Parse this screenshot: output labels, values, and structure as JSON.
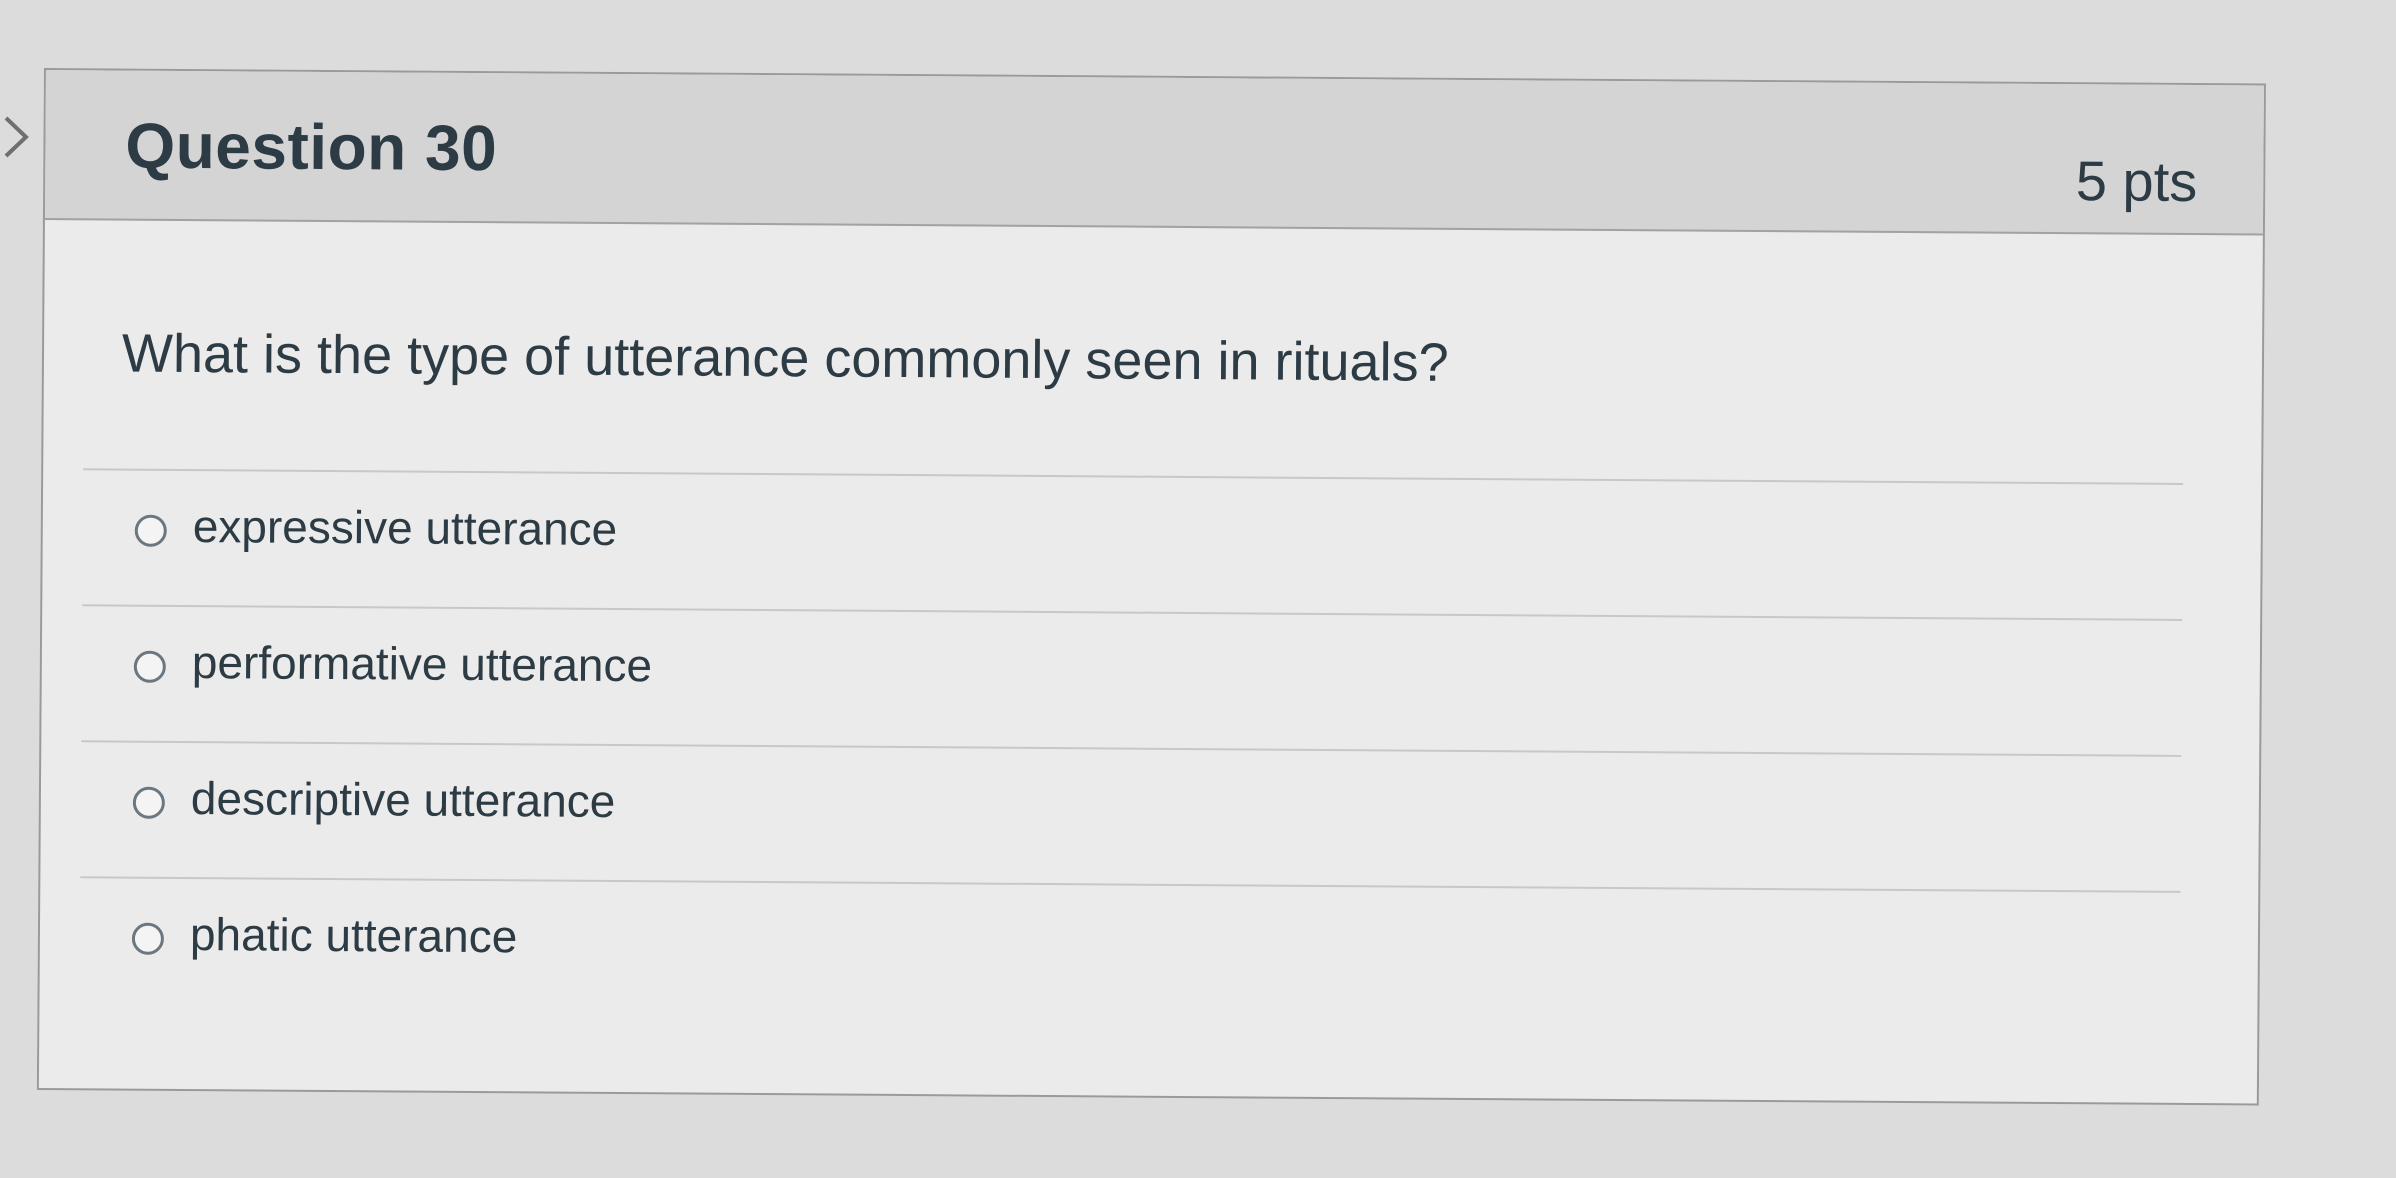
{
  "question": {
    "title": "Question 30",
    "points": "5 pts",
    "text": "What is the type of utterance commonly seen in rituals?",
    "answers": [
      {
        "label": "expressive utterance",
        "selected": false
      },
      {
        "label": "performative utterance",
        "selected": false
      },
      {
        "label": "descriptive utterance",
        "selected": false
      },
      {
        "label": "phatic utterance",
        "selected": false
      }
    ]
  }
}
